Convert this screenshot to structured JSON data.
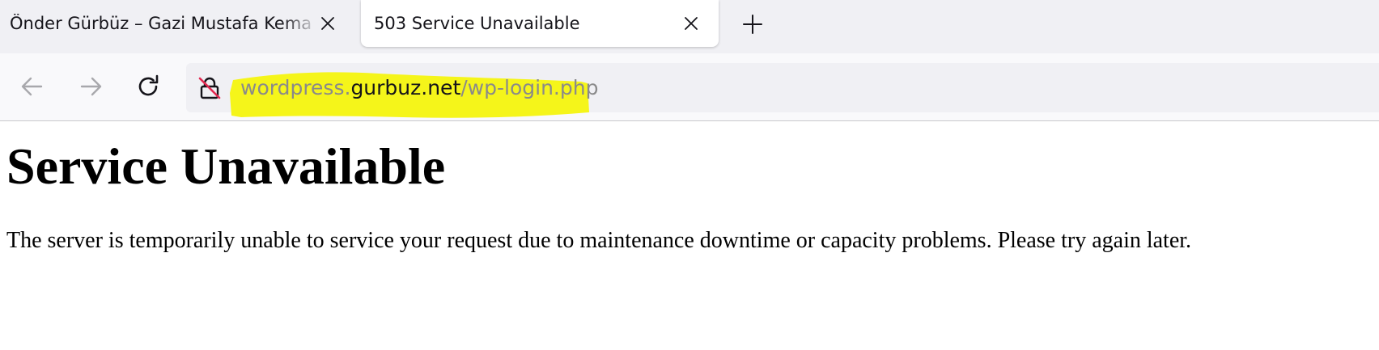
{
  "tabs": [
    {
      "title": "Önder Gürbüz – Gazi Mustafa Kema",
      "active": false,
      "close_icon": "close-icon"
    },
    {
      "title": "503 Service Unavailable",
      "active": true,
      "close_icon": "close-icon"
    }
  ],
  "new_tab_icon": "plus-icon",
  "nav": {
    "back_icon": "arrow-left-icon",
    "forward_icon": "arrow-right-icon",
    "reload_icon": "reload-icon"
  },
  "urlbar": {
    "security_icon": "insecure-lock-icon",
    "url_prefix": "wordpress.",
    "url_host": "gurbuz.net",
    "url_path": "/wp-login.php",
    "highlight_color": "#f5f51a"
  },
  "page": {
    "heading": "Service Unavailable",
    "message": "The server is temporarily unable to service your request due to maintenance downtime or capacity problems. Please try again later."
  }
}
